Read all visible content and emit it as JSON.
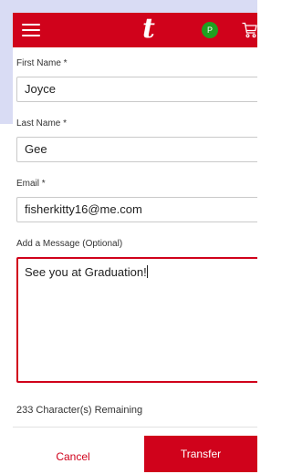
{
  "header": {
    "logo_text": "t",
    "avatar_initial": "P",
    "menu_icon": "hamburger-menu-icon",
    "cart_icon": "shopping-cart-icon",
    "brand_color": "#d0021b",
    "avatar_color": "#20a020"
  },
  "form": {
    "first_name": {
      "label": "First Name *",
      "value": "Joyce"
    },
    "last_name": {
      "label": "Last Name *",
      "value": "Gee"
    },
    "email": {
      "label": "Email *",
      "value": "fisherkitty16@me.com"
    },
    "message": {
      "label": "Add a Message (Optional)",
      "value": "See you at Graduation!"
    },
    "remaining_text": "233 Character(s) Remaining"
  },
  "actions": {
    "cancel_label": "Cancel",
    "transfer_label": "Transfer"
  }
}
